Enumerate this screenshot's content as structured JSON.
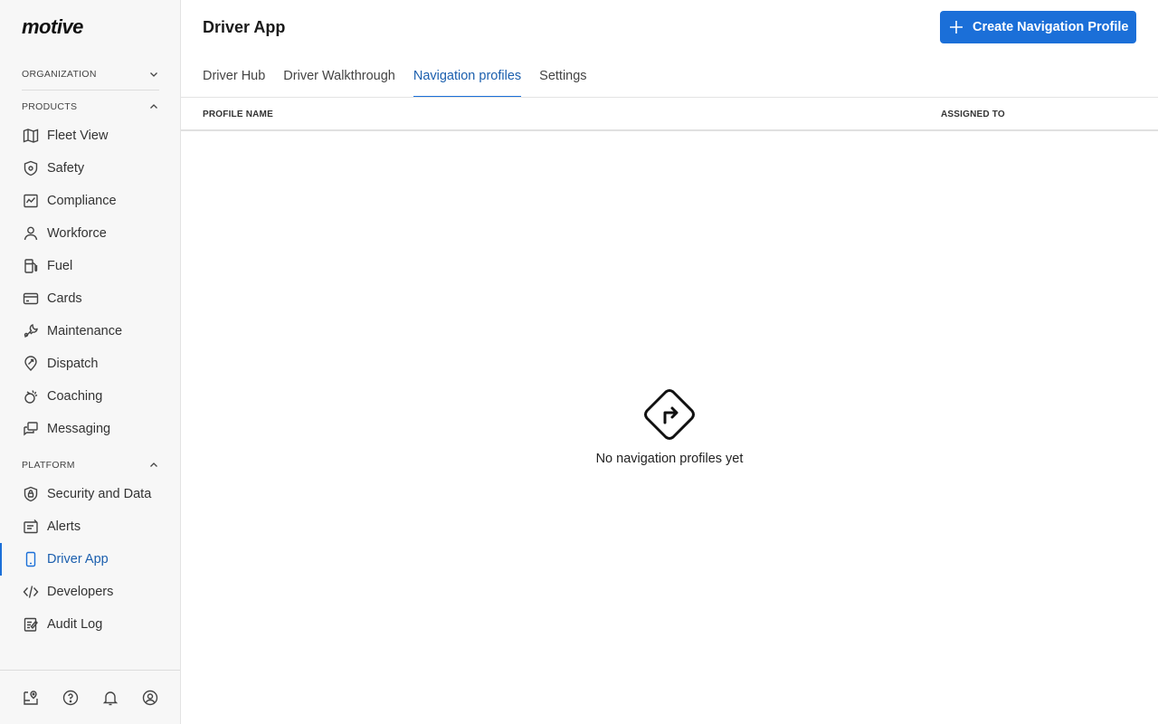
{
  "sidebar": {
    "logo": "motive",
    "sections": {
      "organization": "ORGANIZATION",
      "products": "PRODUCTS",
      "platform": "PLATFORM"
    },
    "products": [
      {
        "label": "Fleet View",
        "icon": "map-icon"
      },
      {
        "label": "Safety",
        "icon": "shield-icon"
      },
      {
        "label": "Compliance",
        "icon": "compliance-icon"
      },
      {
        "label": "Workforce",
        "icon": "person-icon"
      },
      {
        "label": "Fuel",
        "icon": "fuel-icon"
      },
      {
        "label": "Cards",
        "icon": "card-icon"
      },
      {
        "label": "Maintenance",
        "icon": "wrench-icon"
      },
      {
        "label": "Dispatch",
        "icon": "dispatch-icon"
      },
      {
        "label": "Coaching",
        "icon": "coaching-icon"
      },
      {
        "label": "Messaging",
        "icon": "messaging-icon"
      }
    ],
    "platform": [
      {
        "label": "Security and Data",
        "icon": "lock-shield-icon"
      },
      {
        "label": "Alerts",
        "icon": "alerts-icon"
      },
      {
        "label": "Driver App",
        "icon": "phone-icon",
        "active": true
      },
      {
        "label": "Developers",
        "icon": "code-icon"
      },
      {
        "label": "Audit Log",
        "icon": "audit-log-icon"
      }
    ],
    "footer_icons": [
      "map-pin-book-icon",
      "help-icon",
      "bell-icon",
      "user-circle-icon"
    ]
  },
  "header": {
    "title": "Driver App",
    "primary_button": "Create Navigation Profile"
  },
  "tabs": [
    {
      "label": "Driver Hub"
    },
    {
      "label": "Driver Walkthrough"
    },
    {
      "label": "Navigation profiles",
      "active": true
    },
    {
      "label": "Settings"
    }
  ],
  "table": {
    "columns": [
      "PROFILE NAME",
      "ASSIGNED TO"
    ]
  },
  "empty_state": {
    "icon": "turn-right-sign-icon",
    "message": "No navigation profiles yet"
  },
  "colors": {
    "accent": "#1b6fd8",
    "active_text": "#1b5fae"
  }
}
